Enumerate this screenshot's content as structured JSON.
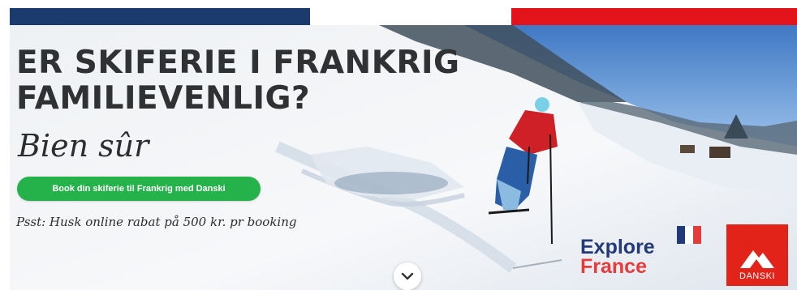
{
  "banner": {
    "flag_colors": [
      "#1b3a6e",
      "#ffffff",
      "#e3131b"
    ],
    "headline_lines": [
      "ER SKIFERIE I FRANKRIG",
      "FAMILIEVENLIG?"
    ],
    "script_text": "Bien sûr",
    "cta_label": "Book din skiferie til Frankrig med Danski",
    "note": "Psst: Husk online rabat på 500 kr. pr booking",
    "scroll_icon": "chevron-down-icon",
    "accent_green": "#25b24a"
  },
  "logos": {
    "explore_line1": "Explore",
    "explore_line2": "France",
    "danski_label": "DANSKI",
    "french_flag_colors": [
      "#233a7a",
      "#ffffff",
      "#e63b3b"
    ]
  }
}
